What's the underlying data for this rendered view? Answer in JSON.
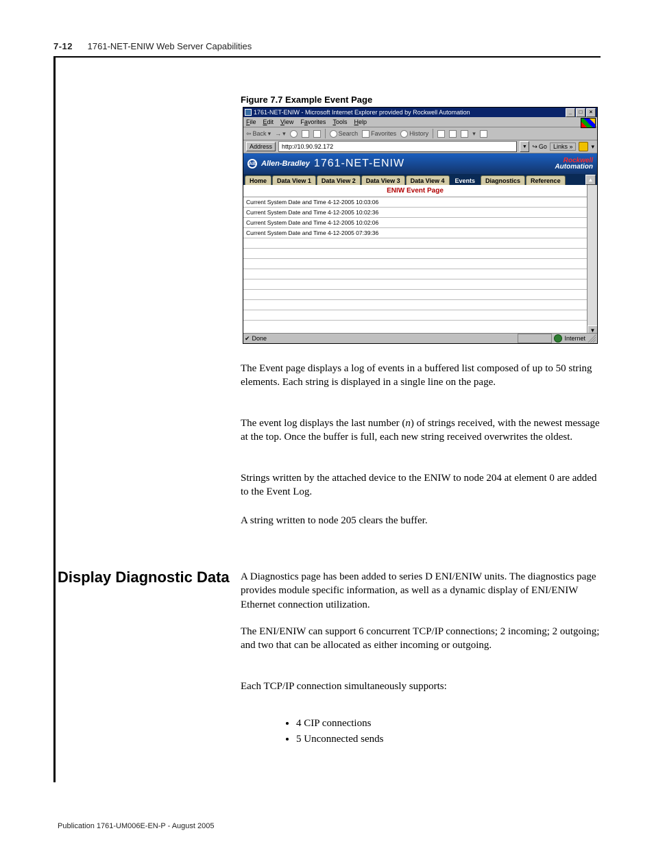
{
  "header": {
    "page_number": "7-12",
    "chapter_title": "1761-NET-ENIW Web Server Capabilities"
  },
  "figure": {
    "caption": "Figure 7.7 Example Event Page"
  },
  "browser": {
    "title": "1761-NET-ENIW - Microsoft Internet Explorer provided by Rockwell Automation",
    "min_btn": "_",
    "max_btn": "□",
    "close_btn": "×",
    "menu": {
      "file": "File",
      "edit": "Edit",
      "view": "View",
      "favorites": "Favorites",
      "tools": "Tools",
      "help": "Help"
    },
    "toolbar": {
      "back": "Back",
      "forward": "→",
      "stop_icon": "stop",
      "refresh_icon": "refresh",
      "home_icon": "home",
      "search": "Search",
      "favorites": "Favorites",
      "history": "History",
      "mail_icon": "mail",
      "print_icon": "print",
      "edit_icon": "edit",
      "discuss_icon": "discuss"
    },
    "address_label": "Address",
    "address_value": "http://10.90.92.172",
    "go_label": "Go",
    "links_label": "Links »",
    "status_left": "Done",
    "status_right": "Internet"
  },
  "webpage": {
    "brand_left": "Allen-Bradley",
    "brand_logo_text": "AB",
    "product_title": "1761-NET-ENIW",
    "brand_right_line1": "Rockwell",
    "brand_right_line2": "Automation",
    "tabs": {
      "home": "Home",
      "dv1": "Data View 1",
      "dv2": "Data View 2",
      "dv3": "Data View 3",
      "dv4": "Data View 4",
      "events": "Events",
      "diagnostics": "Diagnostics",
      "reference": "Reference"
    },
    "event_title": "ENIW Event Page",
    "events": [
      "Current System Date and Time 4-12-2005 10:03:06",
      "Current System Date and Time 4-12-2005 10:02:36",
      "Current System Date and Time 4-12-2005 10:02:06",
      "Current System Date and Time 4-12-2005 07:39:36"
    ],
    "scroll_up": "▲",
    "scroll_down": "▼"
  },
  "body": {
    "p1": "The Event page displays a log of events in a buffered list composed of up to 50 string elements. Each string is displayed in a single line on the page.",
    "p2a": "The event log displays the last number (",
    "p2n": "n",
    "p2b": ") of strings received, with the newest message at the top. Once the buffer is full, each new string received overwrites the oldest.",
    "p3": "Strings written by the attached device to the ENIW to node 204 at element 0 are added to the Event Log.",
    "p4": "A string written to node 205 clears the buffer.",
    "section_title": "Display Diagnostic Data",
    "p5": "A Diagnostics page has been added to series D ENI/ENIW units. The diagnostics page provides module specific information, as well as a dynamic display of ENI/ENIW Ethernet connection utilization.",
    "p6": "The ENI/ENIW can support 6 concurrent TCP/IP connections; 2 incoming; 2 outgoing; and two that can be allocated as either incoming or outgoing.",
    "p7": "Each TCP/IP connection simultaneously supports:",
    "b1": "4 CIP connections",
    "b2": "5 Unconnected sends"
  },
  "footer": {
    "pub": "Publication 1761-UM006E-EN-P - August 2005"
  }
}
